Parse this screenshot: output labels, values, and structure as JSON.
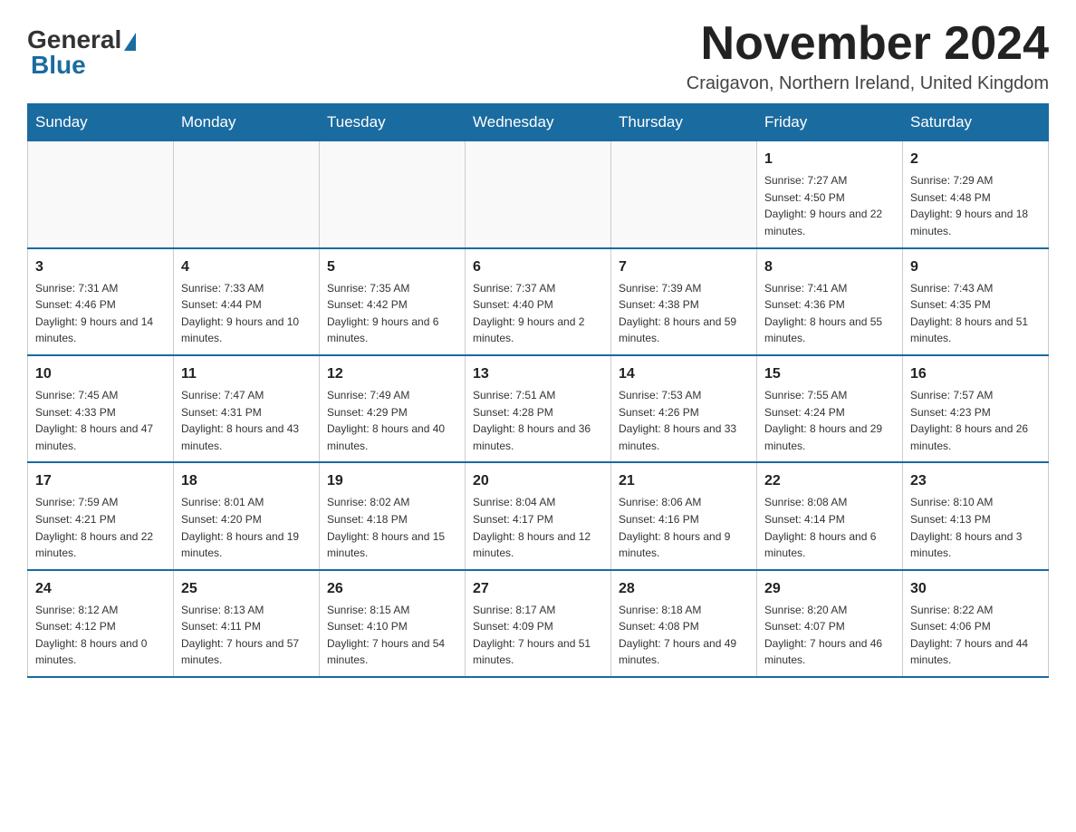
{
  "header": {
    "logo_general": "General",
    "logo_blue": "Blue",
    "month_title": "November 2024",
    "location": "Craigavon, Northern Ireland, United Kingdom"
  },
  "columns": [
    "Sunday",
    "Monday",
    "Tuesday",
    "Wednesday",
    "Thursday",
    "Friday",
    "Saturday"
  ],
  "weeks": [
    [
      {
        "day": "",
        "info": ""
      },
      {
        "day": "",
        "info": ""
      },
      {
        "day": "",
        "info": ""
      },
      {
        "day": "",
        "info": ""
      },
      {
        "day": "",
        "info": ""
      },
      {
        "day": "1",
        "info": "Sunrise: 7:27 AM\nSunset: 4:50 PM\nDaylight: 9 hours and 22 minutes."
      },
      {
        "day": "2",
        "info": "Sunrise: 7:29 AM\nSunset: 4:48 PM\nDaylight: 9 hours and 18 minutes."
      }
    ],
    [
      {
        "day": "3",
        "info": "Sunrise: 7:31 AM\nSunset: 4:46 PM\nDaylight: 9 hours and 14 minutes."
      },
      {
        "day": "4",
        "info": "Sunrise: 7:33 AM\nSunset: 4:44 PM\nDaylight: 9 hours and 10 minutes."
      },
      {
        "day": "5",
        "info": "Sunrise: 7:35 AM\nSunset: 4:42 PM\nDaylight: 9 hours and 6 minutes."
      },
      {
        "day": "6",
        "info": "Sunrise: 7:37 AM\nSunset: 4:40 PM\nDaylight: 9 hours and 2 minutes."
      },
      {
        "day": "7",
        "info": "Sunrise: 7:39 AM\nSunset: 4:38 PM\nDaylight: 8 hours and 59 minutes."
      },
      {
        "day": "8",
        "info": "Sunrise: 7:41 AM\nSunset: 4:36 PM\nDaylight: 8 hours and 55 minutes."
      },
      {
        "day": "9",
        "info": "Sunrise: 7:43 AM\nSunset: 4:35 PM\nDaylight: 8 hours and 51 minutes."
      }
    ],
    [
      {
        "day": "10",
        "info": "Sunrise: 7:45 AM\nSunset: 4:33 PM\nDaylight: 8 hours and 47 minutes."
      },
      {
        "day": "11",
        "info": "Sunrise: 7:47 AM\nSunset: 4:31 PM\nDaylight: 8 hours and 43 minutes."
      },
      {
        "day": "12",
        "info": "Sunrise: 7:49 AM\nSunset: 4:29 PM\nDaylight: 8 hours and 40 minutes."
      },
      {
        "day": "13",
        "info": "Sunrise: 7:51 AM\nSunset: 4:28 PM\nDaylight: 8 hours and 36 minutes."
      },
      {
        "day": "14",
        "info": "Sunrise: 7:53 AM\nSunset: 4:26 PM\nDaylight: 8 hours and 33 minutes."
      },
      {
        "day": "15",
        "info": "Sunrise: 7:55 AM\nSunset: 4:24 PM\nDaylight: 8 hours and 29 minutes."
      },
      {
        "day": "16",
        "info": "Sunrise: 7:57 AM\nSunset: 4:23 PM\nDaylight: 8 hours and 26 minutes."
      }
    ],
    [
      {
        "day": "17",
        "info": "Sunrise: 7:59 AM\nSunset: 4:21 PM\nDaylight: 8 hours and 22 minutes."
      },
      {
        "day": "18",
        "info": "Sunrise: 8:01 AM\nSunset: 4:20 PM\nDaylight: 8 hours and 19 minutes."
      },
      {
        "day": "19",
        "info": "Sunrise: 8:02 AM\nSunset: 4:18 PM\nDaylight: 8 hours and 15 minutes."
      },
      {
        "day": "20",
        "info": "Sunrise: 8:04 AM\nSunset: 4:17 PM\nDaylight: 8 hours and 12 minutes."
      },
      {
        "day": "21",
        "info": "Sunrise: 8:06 AM\nSunset: 4:16 PM\nDaylight: 8 hours and 9 minutes."
      },
      {
        "day": "22",
        "info": "Sunrise: 8:08 AM\nSunset: 4:14 PM\nDaylight: 8 hours and 6 minutes."
      },
      {
        "day": "23",
        "info": "Sunrise: 8:10 AM\nSunset: 4:13 PM\nDaylight: 8 hours and 3 minutes."
      }
    ],
    [
      {
        "day": "24",
        "info": "Sunrise: 8:12 AM\nSunset: 4:12 PM\nDaylight: 8 hours and 0 minutes."
      },
      {
        "day": "25",
        "info": "Sunrise: 8:13 AM\nSunset: 4:11 PM\nDaylight: 7 hours and 57 minutes."
      },
      {
        "day": "26",
        "info": "Sunrise: 8:15 AM\nSunset: 4:10 PM\nDaylight: 7 hours and 54 minutes."
      },
      {
        "day": "27",
        "info": "Sunrise: 8:17 AM\nSunset: 4:09 PM\nDaylight: 7 hours and 51 minutes."
      },
      {
        "day": "28",
        "info": "Sunrise: 8:18 AM\nSunset: 4:08 PM\nDaylight: 7 hours and 49 minutes."
      },
      {
        "day": "29",
        "info": "Sunrise: 8:20 AM\nSunset: 4:07 PM\nDaylight: 7 hours and 46 minutes."
      },
      {
        "day": "30",
        "info": "Sunrise: 8:22 AM\nSunset: 4:06 PM\nDaylight: 7 hours and 44 minutes."
      }
    ]
  ]
}
